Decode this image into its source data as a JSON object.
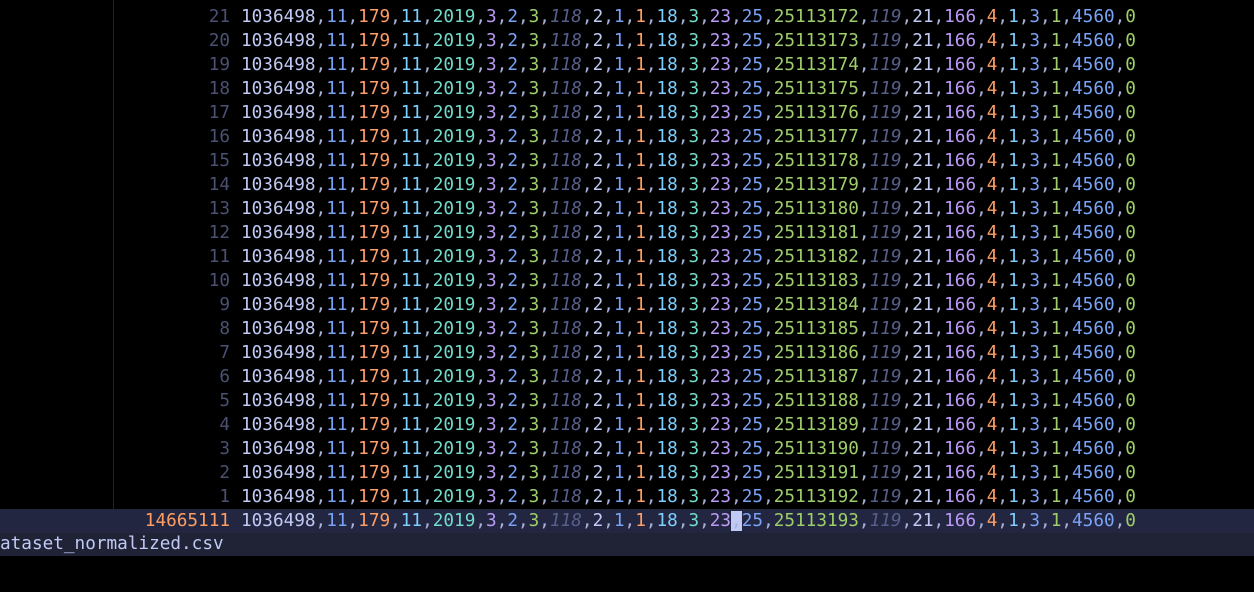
{
  "editor": {
    "filename": "ataset_normalized.csv",
    "cursor_column": 97,
    "lines": [
      {
        "number": "21",
        "text": "1036498,11,179,11,2019,3,2,3,118,2,1,1,18,3,23,25,25113172,119,21,166,4,1,3,1,4560,0"
      },
      {
        "number": "20",
        "text": "1036498,11,179,11,2019,3,2,3,118,2,1,1,18,3,23,25,25113173,119,21,166,4,1,3,1,4560,0"
      },
      {
        "number": "19",
        "text": "1036498,11,179,11,2019,3,2,3,118,2,1,1,18,3,23,25,25113174,119,21,166,4,1,3,1,4560,0"
      },
      {
        "number": "18",
        "text": "1036498,11,179,11,2019,3,2,3,118,2,1,1,18,3,23,25,25113175,119,21,166,4,1,3,1,4560,0"
      },
      {
        "number": "17",
        "text": "1036498,11,179,11,2019,3,2,3,118,2,1,1,18,3,23,25,25113176,119,21,166,4,1,3,1,4560,0"
      },
      {
        "number": "16",
        "text": "1036498,11,179,11,2019,3,2,3,118,2,1,1,18,3,23,25,25113177,119,21,166,4,1,3,1,4560,0"
      },
      {
        "number": "15",
        "text": "1036498,11,179,11,2019,3,2,3,118,2,1,1,18,3,23,25,25113178,119,21,166,4,1,3,1,4560,0"
      },
      {
        "number": "14",
        "text": "1036498,11,179,11,2019,3,2,3,118,2,1,1,18,3,23,25,25113179,119,21,166,4,1,3,1,4560,0"
      },
      {
        "number": "13",
        "text": "1036498,11,179,11,2019,3,2,3,118,2,1,1,18,3,23,25,25113180,119,21,166,4,1,3,1,4560,0"
      },
      {
        "number": "12",
        "text": "1036498,11,179,11,2019,3,2,3,118,2,1,1,18,3,23,25,25113181,119,21,166,4,1,3,1,4560,0"
      },
      {
        "number": "11",
        "text": "1036498,11,179,11,2019,3,2,3,118,2,1,1,18,3,23,25,25113182,119,21,166,4,1,3,1,4560,0"
      },
      {
        "number": "10",
        "text": "1036498,11,179,11,2019,3,2,3,118,2,1,1,18,3,23,25,25113183,119,21,166,4,1,3,1,4560,0"
      },
      {
        "number": "9",
        "text": "1036498,11,179,11,2019,3,2,3,118,2,1,1,18,3,23,25,25113184,119,21,166,4,1,3,1,4560,0"
      },
      {
        "number": "8",
        "text": "1036498,11,179,11,2019,3,2,3,118,2,1,1,18,3,23,25,25113185,119,21,166,4,1,3,1,4560,0"
      },
      {
        "number": "7",
        "text": "1036498,11,179,11,2019,3,2,3,118,2,1,1,18,3,23,25,25113186,119,21,166,4,1,3,1,4560,0"
      },
      {
        "number": "6",
        "text": "1036498,11,179,11,2019,3,2,3,118,2,1,1,18,3,23,25,25113187,119,21,166,4,1,3,1,4560,0"
      },
      {
        "number": "5",
        "text": "1036498,11,179,11,2019,3,2,3,118,2,1,1,18,3,23,25,25113188,119,21,166,4,1,3,1,4560,0"
      },
      {
        "number": "4",
        "text": "1036498,11,179,11,2019,3,2,3,118,2,1,1,18,3,23,25,25113189,119,21,166,4,1,3,1,4560,0"
      },
      {
        "number": "3",
        "text": "1036498,11,179,11,2019,3,2,3,118,2,1,1,18,3,23,25,25113190,119,21,166,4,1,3,1,4560,0"
      },
      {
        "number": "2",
        "text": "1036498,11,179,11,2019,3,2,3,118,2,1,1,18,3,23,25,25113191,119,21,166,4,1,3,1,4560,0"
      },
      {
        "number": "1",
        "text": "1036498,11,179,11,2019,3,2,3,118,2,1,1,18,3,23,25,25113192,119,21,166,4,1,3,1,4560,0"
      },
      {
        "number": "14665111",
        "text": "1036498,11,179,11,2019,3,2,3,118,2,1,1,18,3,23,25,25113193,119,21,166,4,1,3,1,4560,0",
        "current": true
      }
    ]
  },
  "theme": {
    "separator": "#a9b1d6",
    "column_colors": [
      {
        "color": "#c0caf5",
        "italic": false
      },
      {
        "color": "#7aa2f7",
        "italic": false
      },
      {
        "color": "#ff9e64",
        "italic": false
      },
      {
        "color": "#7dcfff",
        "italic": false
      },
      {
        "color": "#73daca",
        "italic": false
      },
      {
        "color": "#bb9af7",
        "italic": false
      },
      {
        "color": "#7aa2f7",
        "italic": false
      },
      {
        "color": "#9ece6a",
        "italic": false
      },
      {
        "color": "#565f89",
        "italic": true
      },
      {
        "color": "#c0caf5",
        "italic": false
      },
      {
        "color": "#7aa2f7",
        "italic": false
      },
      {
        "color": "#ff9e64",
        "italic": false
      },
      {
        "color": "#7dcfff",
        "italic": false
      },
      {
        "color": "#73daca",
        "italic": false
      },
      {
        "color": "#bb9af7",
        "italic": false
      },
      {
        "color": "#7aa2f7",
        "italic": false
      },
      {
        "color": "#9ece6a",
        "italic": false
      },
      {
        "color": "#565f89",
        "italic": true
      },
      {
        "color": "#c0caf5",
        "italic": false
      },
      {
        "color": "#bb9af7",
        "italic": false
      },
      {
        "color": "#ff9e64",
        "italic": false
      },
      {
        "color": "#7dcfff",
        "italic": false
      },
      {
        "color": "#7aa2f7",
        "italic": false
      },
      {
        "color": "#9ece6a",
        "italic": false
      },
      {
        "color": "#7aa2f7",
        "italic": false
      },
      {
        "color": "#9ece6a",
        "italic": false
      }
    ]
  }
}
